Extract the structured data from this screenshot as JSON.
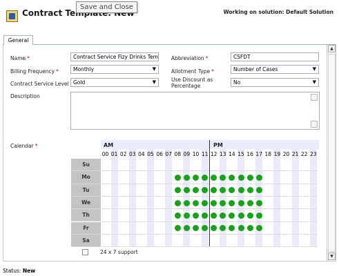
{
  "header": {
    "icon": "contract-template-icon",
    "title": "Contract Template: New",
    "tooltip": "Save and Close",
    "solution": "Working on solution: Default Solution"
  },
  "tabs": [
    {
      "label": "General"
    }
  ],
  "fields": {
    "name": {
      "label": "Name",
      "required": true,
      "value": "Contract Service Fizy Drinks Templ"
    },
    "abbreviation": {
      "label": "Abbreviation",
      "required": true,
      "value": "CSFDT"
    },
    "billing_frequency": {
      "label": "Billing Frequency",
      "required": true,
      "value": "Monthly"
    },
    "allotment_type": {
      "label": "Allotment Type",
      "required": true,
      "value": "Number of Cases"
    },
    "service_level": {
      "label": "Contract Service Level",
      "required": false,
      "value": "Gold"
    },
    "use_discount": {
      "label": "Use Discount as Percentage",
      "required": false,
      "value": "No"
    },
    "description": {
      "label": "Description",
      "value": ""
    }
  },
  "calendar": {
    "label": "Calendar",
    "required": true,
    "am_label": "AM",
    "pm_label": "PM",
    "hours": [
      "00",
      "01",
      "02",
      "03",
      "04",
      "05",
      "06",
      "07",
      "08",
      "09",
      "10",
      "11",
      "12",
      "13",
      "14",
      "15",
      "16",
      "17",
      "18",
      "19",
      "20",
      "21",
      "22",
      "23"
    ],
    "days": [
      "Su",
      "Mo",
      "Tu",
      "We",
      "Th",
      "Fr",
      "Sa"
    ],
    "support": {
      "Su": [],
      "Mo": [
        "08",
        "09",
        "10",
        "11",
        "12",
        "13",
        "14",
        "15",
        "16",
        "17"
      ],
      "Tu": [
        "08",
        "09",
        "10",
        "11",
        "12",
        "13",
        "14",
        "15",
        "16",
        "17"
      ],
      "We": [
        "08",
        "09",
        "10",
        "11",
        "12",
        "13",
        "14",
        "15",
        "16",
        "17"
      ],
      "Th": [
        "08",
        "09",
        "10",
        "11",
        "12",
        "13",
        "14",
        "15",
        "16",
        "17"
      ],
      "Fr": [
        "08",
        "09",
        "10",
        "11",
        "12",
        "13",
        "14",
        "15",
        "16",
        "17"
      ],
      "Sa": []
    },
    "support_color": "#17a317",
    "full_support_label": "24 x 7 support",
    "full_support_checked": false
  },
  "status": {
    "label": "Status:",
    "value": "New"
  }
}
